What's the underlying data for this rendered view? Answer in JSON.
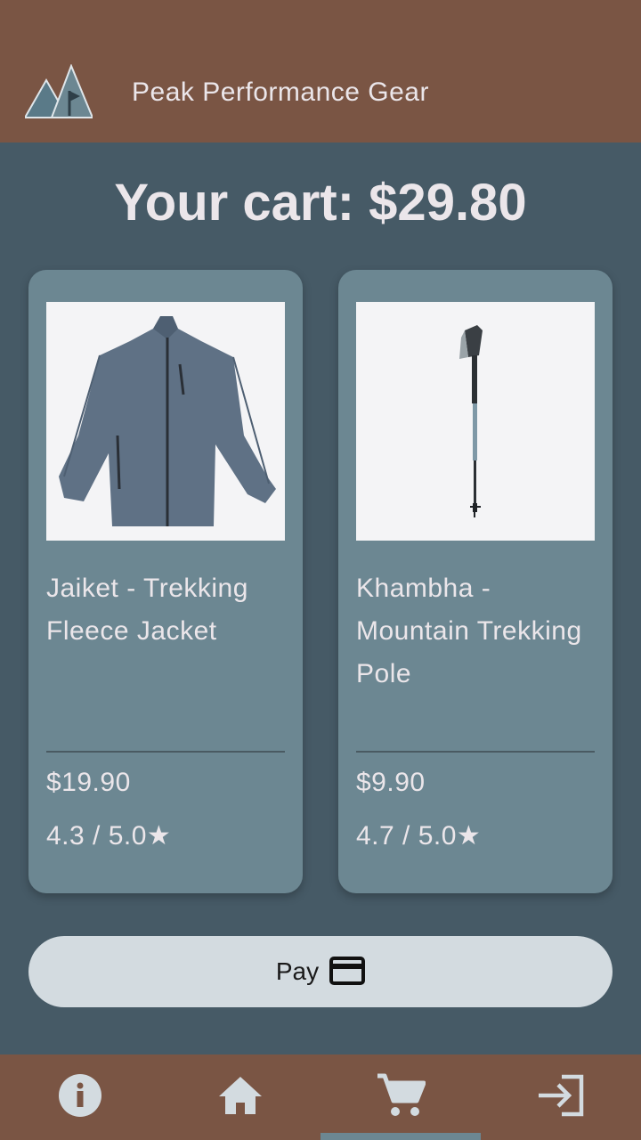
{
  "app": {
    "title": "Peak Performance Gear"
  },
  "cart": {
    "total_text": "Your cart: $29.80"
  },
  "products": [
    {
      "name": "Jaiket - Trekking Fleece Jacket",
      "price": "$19.90",
      "rating": "4.3 / 5.0★",
      "image": "fleece-jacket-image"
    },
    {
      "name": "Khambha - Mountain Trekking Pole",
      "price": "$9.90",
      "rating": "4.7 / 5.0★",
      "image": "trekking-pole-image"
    }
  ],
  "pay": {
    "label": "Pay",
    "icon": "credit-card-icon"
  },
  "nav": {
    "items": [
      {
        "icon": "info-icon"
      },
      {
        "icon": "home-icon"
      },
      {
        "icon": "cart-icon",
        "selected": true
      },
      {
        "icon": "login-icon"
      }
    ]
  },
  "colors": {
    "header": "#7a5544",
    "background": "#465a66",
    "card": "#6c8792",
    "button": "#d3dbe0",
    "text": "#ebe6ea"
  }
}
